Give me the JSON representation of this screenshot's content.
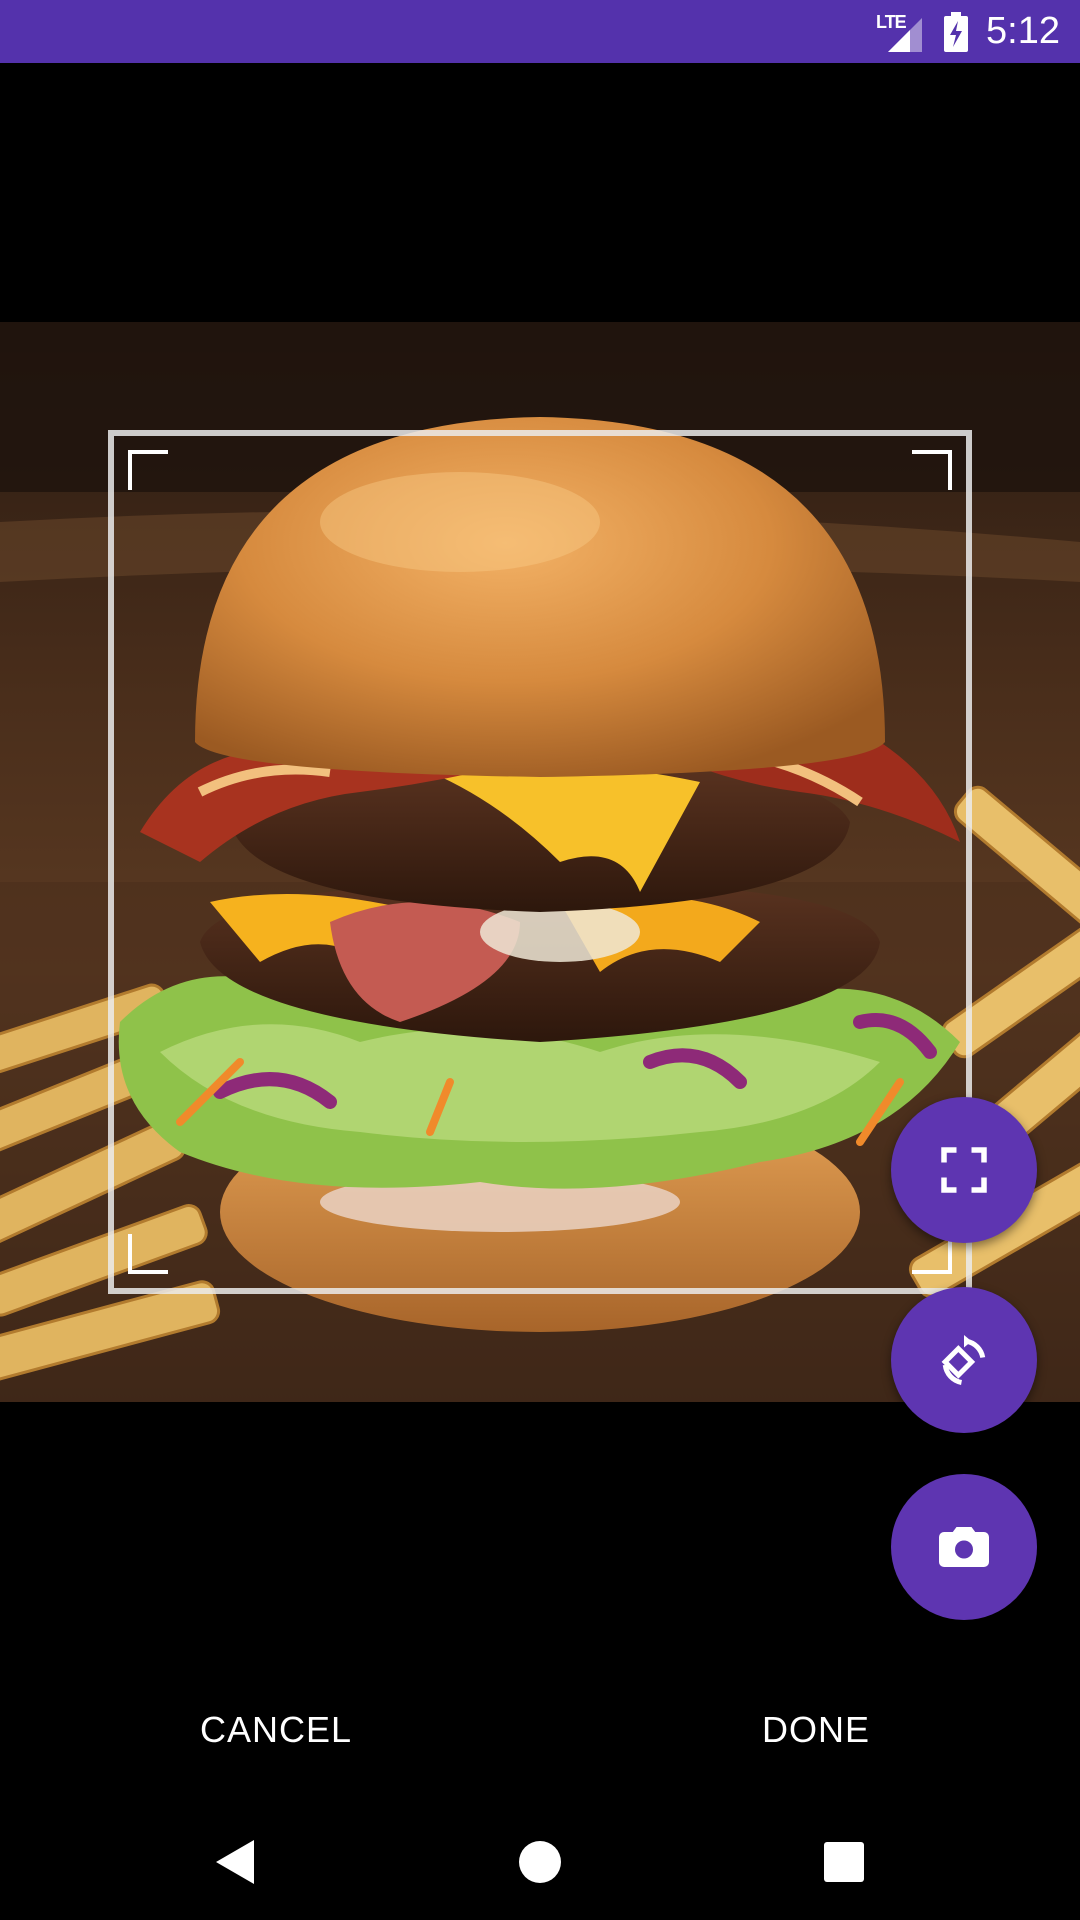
{
  "status_bar": {
    "network_label": "LTE",
    "time": "5:12",
    "network_icon": "cell-signal-icon",
    "battery_icon": "battery-charging-icon",
    "background": "#5432AC"
  },
  "image": {
    "subject": "burger-photo"
  },
  "fabs": {
    "fullscreen_icon": "fullscreen-icon",
    "rotate_icon": "rotate-icon",
    "camera_icon": "camera-icon",
    "color": "#5E35B1"
  },
  "actions": {
    "cancel_label": "CANCEL",
    "done_label": "DONE"
  },
  "nav": {
    "back_icon": "back-icon",
    "home_icon": "home-icon",
    "recents_icon": "recents-icon"
  }
}
